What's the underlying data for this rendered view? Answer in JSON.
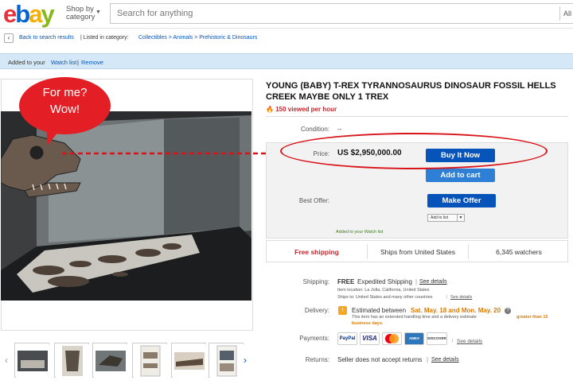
{
  "header": {
    "logo_letters": [
      "e",
      "b",
      "a",
      "y"
    ],
    "shop_by_line1": "Shop by",
    "shop_by_line2": "category",
    "search_placeholder": "Search for anything",
    "search_category": "All"
  },
  "breadcrumb": {
    "back_label": "Back to search results",
    "listed_in": "| Listed in category:",
    "path": "Collectibles > Animals > Prehistoric & Dinosaurs"
  },
  "banner": {
    "added_text": "Added to your",
    "watch_list_link": "Watch list",
    "separator": "|",
    "remove_link": "Remove"
  },
  "image": {
    "bubble_line1": "For me?",
    "bubble_line2": "Wow!"
  },
  "listing": {
    "title": "YOUNG (BABY) T-REX TYRANNOSAURUS DINOSAUR FOSSIL HELLS CREEK MAYBE ONLY 1 TREX",
    "views": "150 viewed per hour",
    "condition_label": "Condition:",
    "condition_value": "--",
    "price_label": "Price:",
    "price_value": "US $2,950,000.00",
    "buy_now": "Buy It Now",
    "add_to_cart": "Add to cart",
    "best_offer_label": "Best Offer:",
    "make_offer": "Make Offer",
    "add_to_list": "Add to list",
    "watch_note": "Added to your Watch list"
  },
  "ship_row": {
    "free_shipping": "Free shipping",
    "ships_from": "Ships from United States",
    "watchers": "6,345 watchers"
  },
  "details": {
    "shipping_label": "Shipping:",
    "shipping_free": "FREE",
    "shipping_method": "Expedited Shipping",
    "see_details": "See details",
    "item_location": "Item location:  La Jolla, California, United States",
    "ships_to": "Ships to:  United States and many other countries",
    "delivery_label": "Delivery:",
    "delivery_estimate": "Estimated between",
    "delivery_dates": "Sat. May. 18 and Mon. May. 20",
    "handling_note": "This item has an extended handling time and a delivery estimate",
    "handling_days": "greater than 15 business days.",
    "payments_label": "Payments:",
    "payment_icons": [
      "PayPal",
      "VISA",
      "MasterCard",
      "AMEX",
      "DISCOVER"
    ],
    "returns_label": "Returns:",
    "returns_value": "Seller does not accept returns"
  },
  "colors": {
    "ebay_red": "#e53238",
    "ebay_blue": "#0064d2",
    "ebay_yellow": "#f5af02",
    "ebay_green": "#86b817",
    "button_blue": "#0654ba",
    "highlight_red": "#d8131a"
  }
}
